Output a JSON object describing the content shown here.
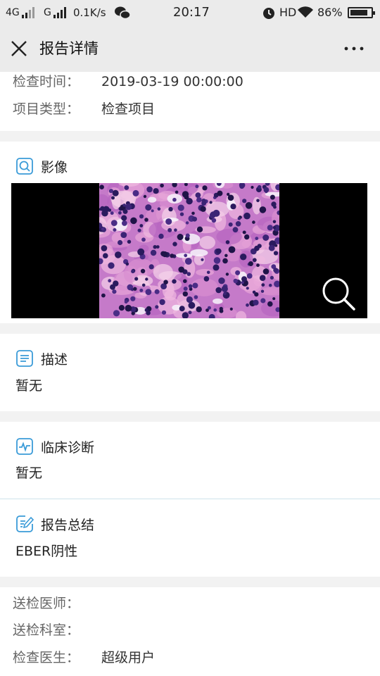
{
  "status_bar": {
    "network_1": "4G",
    "network_2": "G",
    "speed": "0.1K/s",
    "time": "20:17",
    "hd": "HD",
    "battery_text": "86%",
    "battery_level": 0.86
  },
  "nav": {
    "title": "报告详情",
    "close_icon": "close-icon",
    "more_icon": "more-icon"
  },
  "basic_info": [
    {
      "label": "检查时间：",
      "value": "2019-03-19 00:00:00"
    },
    {
      "label": "项目类型：",
      "value": "检查项目"
    }
  ],
  "image_section": {
    "title": "影像",
    "icon": "image-search-icon",
    "zoom_icon": "zoom-icon"
  },
  "description": {
    "title": "描述",
    "icon": "document-icon",
    "text": "暂无"
  },
  "clinical": {
    "title": "临床诊断",
    "icon": "pulse-icon",
    "text": "暂无"
  },
  "summary": {
    "title": "报告总结",
    "icon": "edit-icon",
    "text": "EBER阴性"
  },
  "doctor_info": [
    {
      "label": "送检医师：",
      "value": ""
    },
    {
      "label": "送检科室：",
      "value": ""
    },
    {
      "label": "检查医生：",
      "value": "超级用户"
    }
  ],
  "colors": {
    "accent": "#3a9bd8",
    "divider": "#cde3ea"
  }
}
